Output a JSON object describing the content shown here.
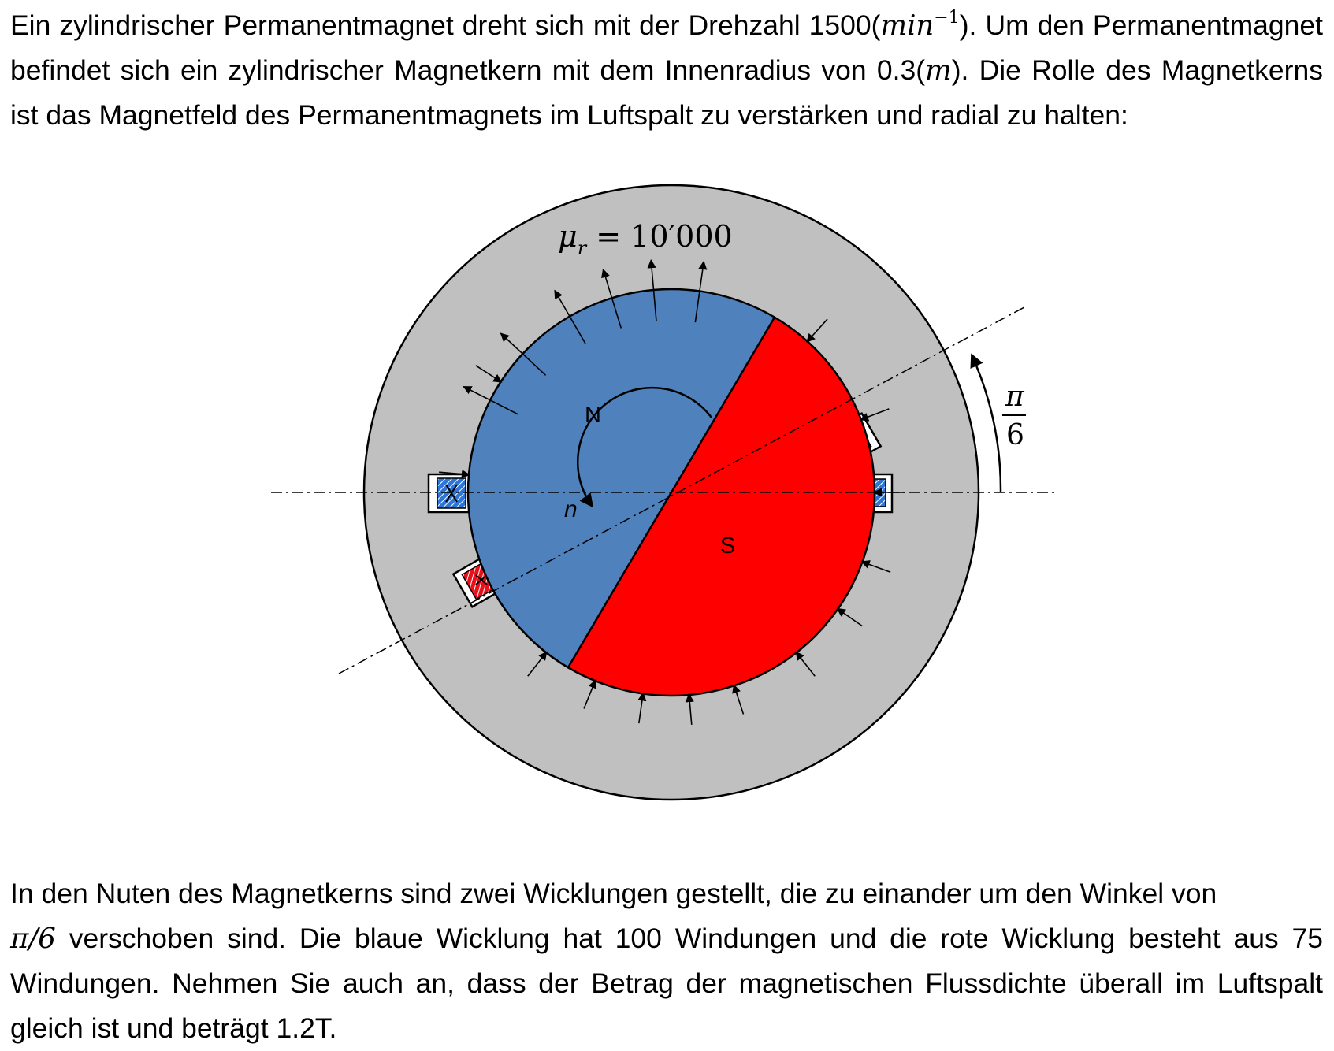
{
  "paragraph1": {
    "t1": "Ein zylindrischer Permanentmagnet dreht sich mit der Drehzahl 1500(",
    "m1": "min",
    "sup1": "−1",
    "t2": "). Um den Permanentmagnet befindet sich ein zylindrischer Magnetkern mit dem Innenradius von 0.3(",
    "m2": "m",
    "t3": "). Die Rolle des Magnetkerns ist das Magnetfeld des Permanentmagnets im Luftspalt zu verstärken und radial zu halten:"
  },
  "figure": {
    "mu_symbol": "μ",
    "mu_sub": "r",
    "mu_value": " = 10′000",
    "north_label": "N",
    "south_label": "S",
    "rotation_label": "n",
    "angle_numerator": "π",
    "angle_denominator": "6",
    "colors": {
      "core": "#c0c0c0",
      "north": "#4f81bd",
      "south": "#ff0000",
      "blue_winding": "#2e75d6",
      "red_winding": "#e8101a",
      "airgap": "#ffffff"
    }
  },
  "paragraph2": {
    "t1": "In den Nuten des Magnetkerns sind zwei Wicklungen gestellt, die zu einander um den Winkel von",
    "m1": "π/6",
    "t2": " verschoben sind. Die blaue Wicklung hat 100 Windungen und die rote Wicklung besteht aus 75 Windungen. Nehmen Sie auch an, dass der Betrag der magnetischen Flussdichte überall im Luftspalt gleich ist und beträgt 1.2T."
  }
}
